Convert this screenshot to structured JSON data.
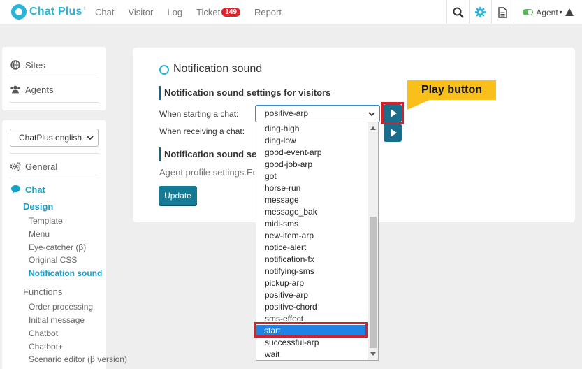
{
  "header": {
    "logo": "Chat Plus",
    "logo_mark": "+",
    "nav": [
      "Chat",
      "Visitor",
      "Log",
      "Ticket",
      "Report"
    ],
    "ticket_badge": "149",
    "agent_label": "Agent"
  },
  "sidebar": {
    "top": [
      "Sites",
      "Agents"
    ],
    "site_select": "ChatPlus english",
    "general": "General",
    "chat": "Chat",
    "design": "Design",
    "design_items": [
      "Template",
      "Menu",
      "Eye-catcher (β)",
      "Original CSS",
      "Notification sound"
    ],
    "functions": "Functions",
    "function_items": [
      "Order processing",
      "Initial message",
      "Chatbot",
      "Chatbot+",
      "Scenario editor (β version)"
    ]
  },
  "main": {
    "title": "Notification sound",
    "section1": "Notification sound settings for visitors",
    "label_start": "When starting a chat:",
    "label_receive": "When receiving a chat:",
    "start_value": "positive-arp",
    "section2": "Notification sound se",
    "profile_text": "Agent profile settings.Ed",
    "update": "Update"
  },
  "dropdown": {
    "options": [
      "ding-high",
      "ding-low",
      "good-event-arp",
      "good-job-arp",
      "got",
      "horse-run",
      "message",
      "message_bak",
      "midi-sms",
      "new-item-arp",
      "notice-alert",
      "notification-fx",
      "notifying-sms",
      "pickup-arp",
      "positive-arp",
      "positive-chord",
      "sms-effect",
      "start",
      "successful-arp",
      "wait"
    ],
    "selected": "start"
  },
  "annotation": {
    "callout": "Play button"
  },
  "colors": {
    "accent": "#2bb3d8",
    "play_button": "#1a6e8c",
    "highlight": "#d4202d",
    "callout": "#f9bf1a",
    "selected_option": "#1e82e6"
  }
}
